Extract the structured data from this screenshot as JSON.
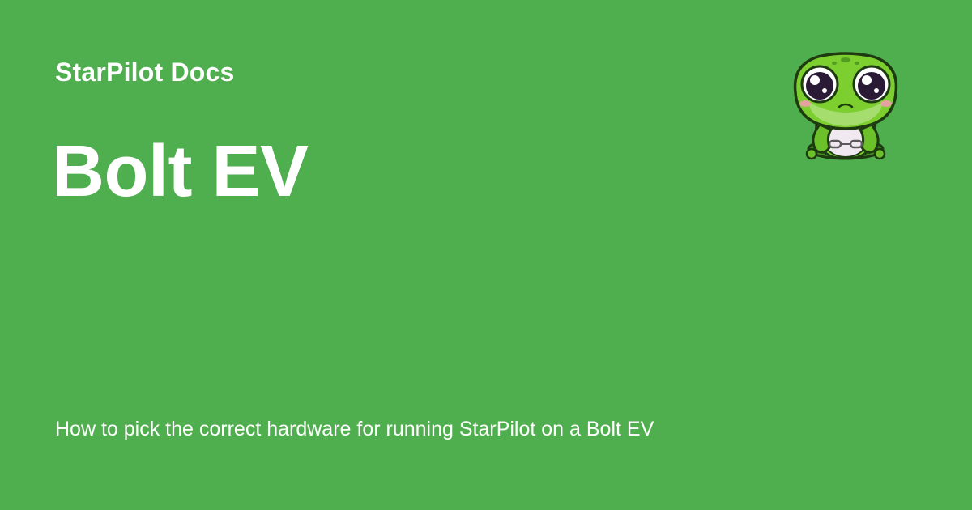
{
  "card": {
    "background_color": "#4fae4e",
    "site_name": "StarPilot Docs",
    "title": "Bolt EV",
    "description": "How to pick the correct hardware for running StarPilot on a Bolt EV",
    "logo_icon": "frog-mascot-icon"
  }
}
